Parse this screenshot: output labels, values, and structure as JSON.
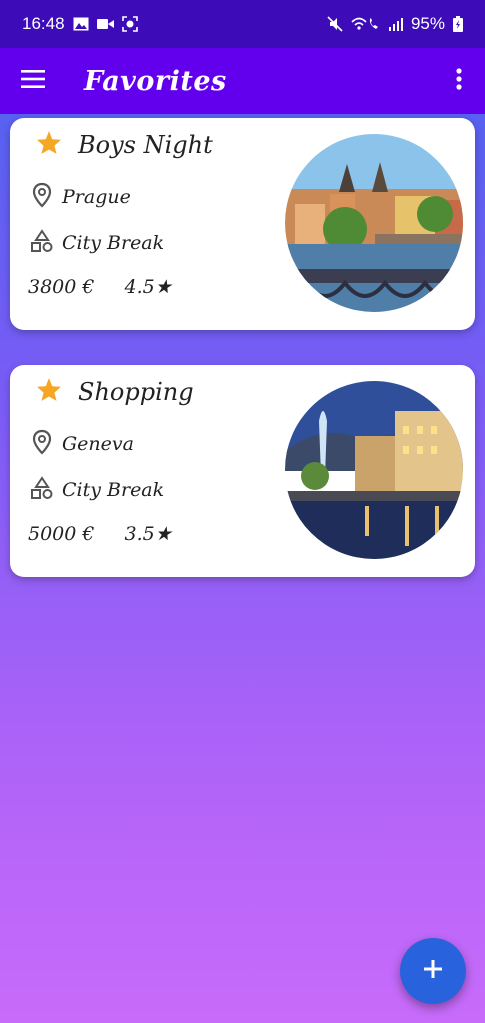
{
  "status_bar": {
    "time": "16:48",
    "battery": "95%"
  },
  "app_bar": {
    "title": "Favorites",
    "menu_icon": "hamburger-menu-icon",
    "more_icon": "more-vert-icon",
    "color": "#6200ee"
  },
  "favorites": [
    {
      "title": "Boys Night",
      "location": "Prague",
      "category": "City Break",
      "price": "3800 €",
      "rating": "4.5★",
      "star_color": "#f5a623"
    },
    {
      "title": "Shopping",
      "location": "Geneva",
      "category": "City Break",
      "price": "5000 €",
      "rating": "3.5★",
      "star_color": "#f5a623"
    }
  ],
  "fab": {
    "icon": "plus-icon",
    "color": "#2962dd"
  }
}
